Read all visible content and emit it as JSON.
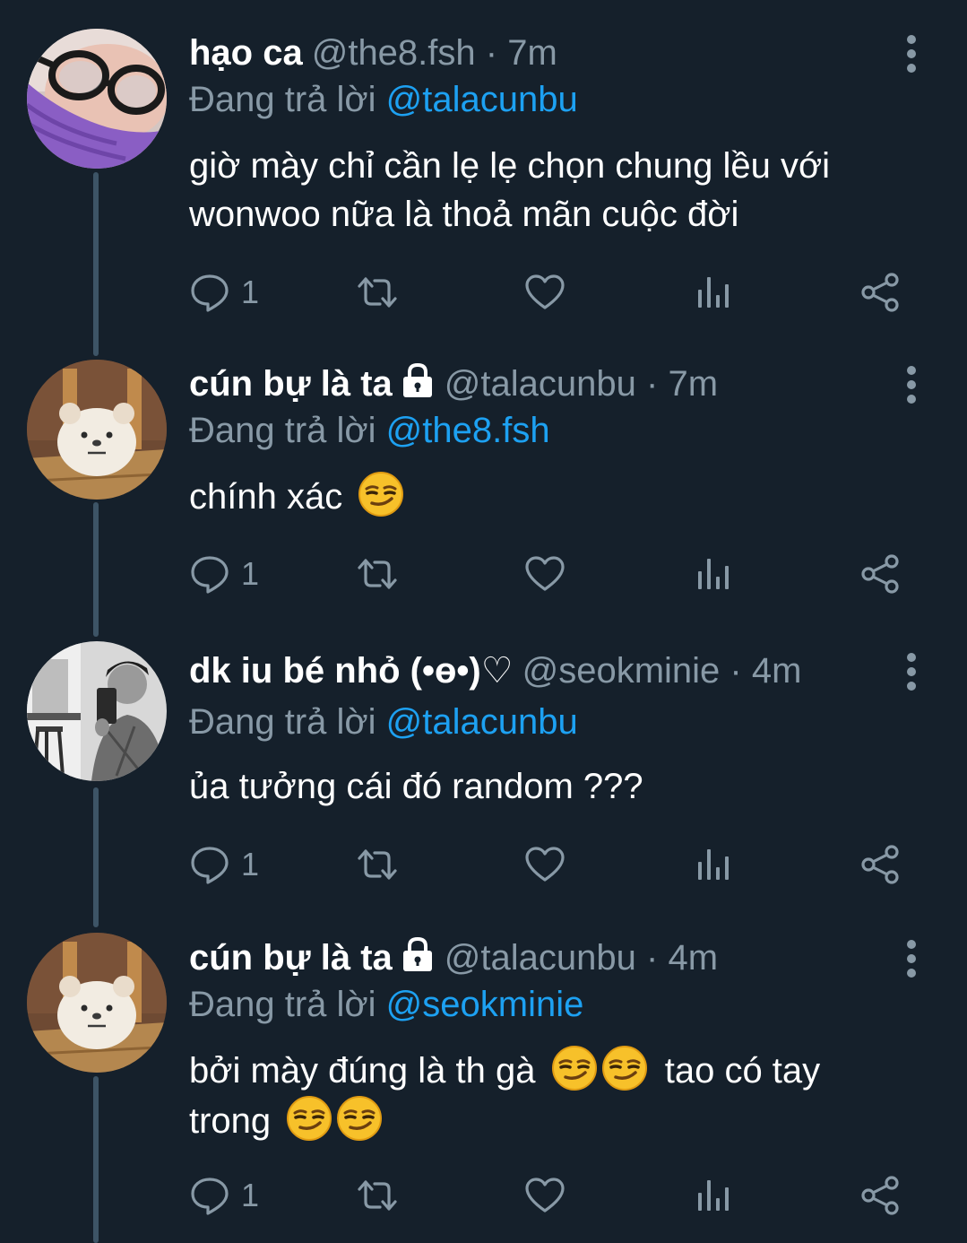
{
  "tweets": [
    {
      "name": "hạo ca",
      "handle": "@the8.fsh",
      "time": "7m",
      "replying_label": "Đang trả lời",
      "replying_to": "@talacunbu",
      "text_lines": [
        "giờ mày chỉ cần lẹ lẹ chọn chung lều với",
        "wonwoo nữa là thoả mãn cuộc đời"
      ],
      "reply_count": "1",
      "locked": false
    },
    {
      "name": "cún bự là ta",
      "handle": "@talacunbu",
      "time": "7m",
      "replying_label": "Đang trả lời",
      "replying_to": "@the8.fsh",
      "text_lines": [
        "chính xác"
      ],
      "reply_count": "1",
      "locked": true
    },
    {
      "name": "dk iu bé nhỏ (•ө•)♡",
      "handle": "@seokminie",
      "time": "4m",
      "replying_label": "Đang trả lời",
      "replying_to": "@talacunbu",
      "text_lines": [
        "ủa tưởng cái đó random ???"
      ],
      "reply_count": "1",
      "locked": false
    },
    {
      "name": "cún bự là ta",
      "handle": "@talacunbu",
      "time": "4m",
      "replying_label": "Đang trả lời",
      "replying_to": "@seokminie",
      "text_lines": [
        "bởi mày đúng là th gà",
        "tao có tay",
        "trong"
      ],
      "reply_count": "1",
      "locked": true
    }
  ],
  "separator": "·",
  "icons": {
    "reply": "reply-icon",
    "retweet": "retweet-icon",
    "like": "heart-icon",
    "analytics": "analytics-icon",
    "share": "share-icon",
    "more": "more-vertical-icon",
    "lock": "lock-icon",
    "emoji": "smirking-face-emoji"
  },
  "colors": {
    "background": "#15202b",
    "text": "#ffffff",
    "secondary": "#8899a6",
    "link": "#1da1f2",
    "thread_line": "#3d5466"
  }
}
